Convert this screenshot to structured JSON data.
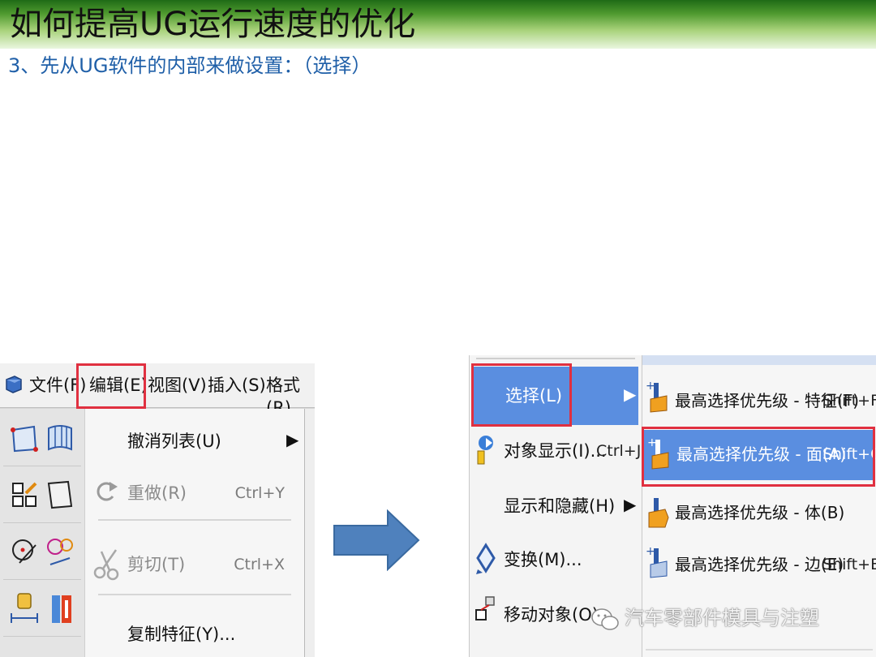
{
  "slide": {
    "title": "如何提高UG运行速度的优化",
    "subtitle": "3、先从UG软件的内部来做设置：（选择）"
  },
  "left_menu": {
    "menubar": [
      "文件(F)",
      "编辑(E)",
      "视图(V)",
      "插入(S)",
      "格式(R)"
    ],
    "edit_items": [
      {
        "label": "撤消列表(U)",
        "shortcut": "",
        "disabled": false,
        "submenu": true
      },
      {
        "label": "重做(R)",
        "shortcut": "Ctrl+Y",
        "disabled": true,
        "submenu": false
      },
      {
        "label": "剪切(T)",
        "shortcut": "Ctrl+X",
        "disabled": true,
        "submenu": false
      },
      {
        "label": "复制特征(Y)...",
        "shortcut": "",
        "disabled": false,
        "submenu": false
      }
    ]
  },
  "right_menu": {
    "main_items": [
      {
        "label": "选择(L)",
        "shortcut": "",
        "submenu": true,
        "selected": true
      },
      {
        "label": "对象显示(I)...",
        "shortcut": "Ctrl+J",
        "submenu": false
      },
      {
        "label": "显示和隐藏(H)",
        "shortcut": "",
        "submenu": true
      },
      {
        "label": "变换(M)...",
        "shortcut": "",
        "submenu": false
      },
      {
        "label": "移动对象(O)...",
        "shortcut": "",
        "submenu": false
      }
    ],
    "submenu_items": [
      {
        "label": "最高选择优先级 - 特征(F)",
        "shortcut": "Shift+F"
      },
      {
        "label": "最高选择优先级 - 面(A)",
        "shortcut": "Shift+C",
        "selected": true
      },
      {
        "label": "最高选择优先级 - 体(B)",
        "shortcut": ""
      },
      {
        "label": "最高选择优先级 - 边(E)",
        "shortcut": "Shift+E"
      }
    ]
  },
  "watermark": "汽车零部件模具与注塑",
  "colors": {
    "highlight_box": "#e03040",
    "menu_selection": "#5a8ee0",
    "subtitle": "#1f5fa8"
  }
}
